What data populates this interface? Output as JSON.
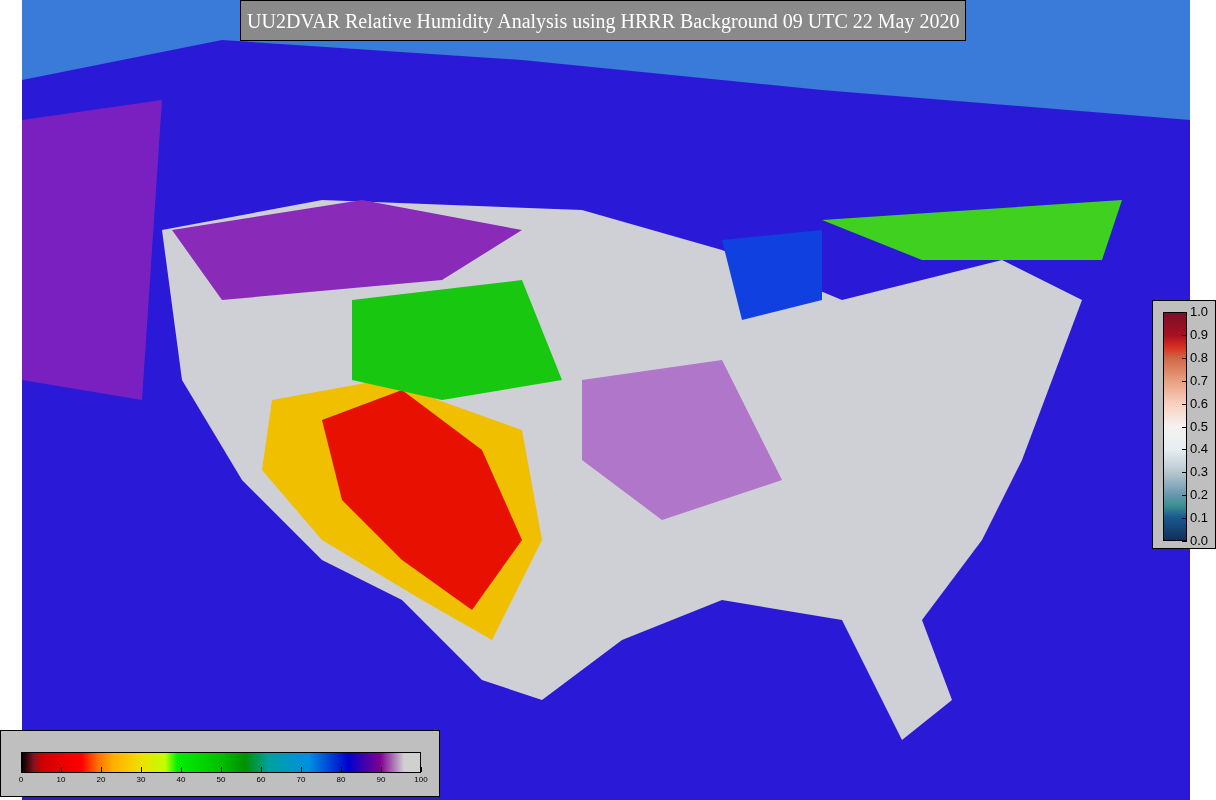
{
  "title": "UU2DVAR Relative Humidity Analysis using HRRR Background 09 UTC 22 May 2020",
  "humidity_scale": {
    "ticks": [
      "0",
      "10",
      "20",
      "30",
      "40",
      "50",
      "60",
      "70",
      "80",
      "90",
      "100"
    ]
  },
  "fraction_scale": {
    "ticks": [
      "1.0",
      "0.9",
      "0.8",
      "0.7",
      "0.6",
      "0.5",
      "0.4",
      "0.3",
      "0.2",
      "0.1",
      "0.0"
    ]
  }
}
